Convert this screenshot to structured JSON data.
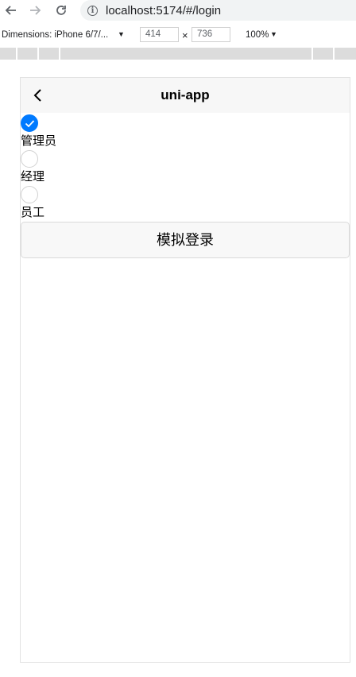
{
  "browser": {
    "url": "localhost:5174/#/login",
    "info_symbol": "i"
  },
  "devtools": {
    "dimensions_label": "Dimensions: iPhone 6/7/...",
    "width": "414",
    "height": "736",
    "times": "×",
    "zoom": "100%"
  },
  "app": {
    "title": "uni-app",
    "roles": [
      {
        "label": "管理员",
        "checked": true
      },
      {
        "label": "经理",
        "checked": false
      },
      {
        "label": "员工",
        "checked": false
      }
    ],
    "login_button": "模拟登录"
  },
  "colors": {
    "accent": "#007aff",
    "header_bg": "#f7f7f7"
  },
  "icons": {
    "back": "back-icon",
    "forward": "forward-icon",
    "reload": "reload-icon",
    "back_arrow": "chevron-left-icon",
    "check": "check-icon",
    "info": "info-icon",
    "caret": "caret-down-icon"
  }
}
